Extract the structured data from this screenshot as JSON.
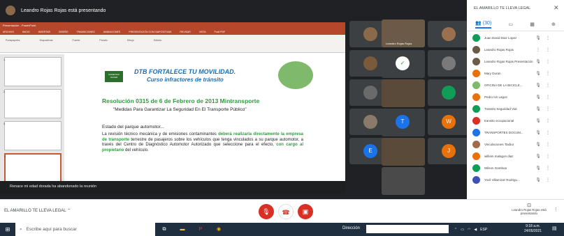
{
  "topbar": {
    "presenting": "Leandro Rojas Rojas está presentando"
  },
  "ppt": {
    "window_title": "Presentación - PowerPoint",
    "tabs": [
      "ARCHIVO",
      "INICIO",
      "INSERTAR",
      "DISEÑO",
      "TRANSICIONES",
      "ANIMACIONES",
      "PRESENTACIÓN CON DIAPOSITIVAS",
      "REVISAR",
      "VISTA",
      "Foxit PDF"
    ],
    "groups": [
      "Portapapeles",
      "Diapositivas",
      "Fuente",
      "Párrafo",
      "Dibujo",
      "Edición"
    ]
  },
  "slide": {
    "logo": "SOMETIDO HACER",
    "title": "DTB FORTALECE TU MOVILIDAD.",
    "subtitle": "Curso infractores de tránsito",
    "resolution": "Resolución 0315 de 6 de Febrero de 2013 Mintransporte",
    "quote": "\"Medidas Para Garantizar La Seguridad En El Transporte Público\"",
    "estado": "Estado del parque automotor...",
    "body_1": "La revisión técnico mecánica y de emisiones contaminantes ",
    "body_hl_1": "deberá realizarla directamente la empresa de transporte",
    "body_2": " terrestre de pasajeros sobre los vehículos que tenga vinculados a su parque automotor, a través del Centro de Diagnóstico Automotor Autorizado que seleccione para el efecto, ",
    "body_hl_2": "con cargo al propietario",
    "body_3": " del vehículo."
  },
  "thumbs": [
    "1",
    "2",
    "3",
    "4",
    "5"
  ],
  "notice": "Renace mi edad dorada ha abandonado la reunión",
  "tiles": [
    {
      "name": "Leandro Rojas Rojas",
      "initial": "",
      "color": "#6b5a48"
    },
    {
      "name": "",
      "initial": "",
      "color": "#3c5a6e"
    },
    {
      "name": "",
      "initial": "T",
      "color": "#1a73e8"
    },
    {
      "name": "",
      "initial": "W",
      "color": "#e8710a"
    },
    {
      "name": "",
      "initial": "E",
      "color": "#1a73e8"
    },
    {
      "name": "",
      "initial": "J",
      "color": "#e8710a"
    },
    {
      "name": "",
      "initial": "",
      "color": "#0f9d58"
    }
  ],
  "panel": {
    "title": "EL AMARILLO TE LLEVA LEGAL",
    "close": "✕",
    "tab_count": "(30)",
    "participants": [
      {
        "name": "Juan David Diaz Lopez",
        "color": "#0f9d58"
      },
      {
        "name": "Leandro Rojas Rojas",
        "color": "#6b5a48"
      },
      {
        "name": "Leandro Rojas Rojas Presentación",
        "color": "#6b5a48"
      },
      {
        "name": "Mary Duran",
        "color": "#e8710a"
      },
      {
        "name": "OFICINA DE LA BICICLE...",
        "color": "#7fb96b"
      },
      {
        "name": "Pedro Ivn Lagos",
        "color": "#e8710a"
      },
      {
        "name": "Transito Seguridad Vial",
        "color": "#0f9d58"
      },
      {
        "name": "transito occupacional",
        "color": "#d93025"
      },
      {
        "name": "TRANSPORTES DOCUM...",
        "color": "#1a73e8"
      },
      {
        "name": "Vinculaciones Taxbur",
        "color": "#9e6b4e"
      },
      {
        "name": "william malagon diaz",
        "color": "#e8710a"
      },
      {
        "name": "Wilson Gamboa",
        "color": "#0f9d58"
      },
      {
        "name": "Yovil Villamizar Rodrigu...",
        "color": "#3f51b5"
      }
    ]
  },
  "bottom": {
    "meeting_name": "EL AMARILLO TE LLEVA LEGAL",
    "presenter": "Leandro Rojas Rojas está presentando"
  },
  "taskbar": {
    "search_placeholder": "Escribe aquí para buscar",
    "direccion": "Dirección",
    "lang": "ESP",
    "time": "9:18 a.m.",
    "date": "24/05/2021"
  }
}
